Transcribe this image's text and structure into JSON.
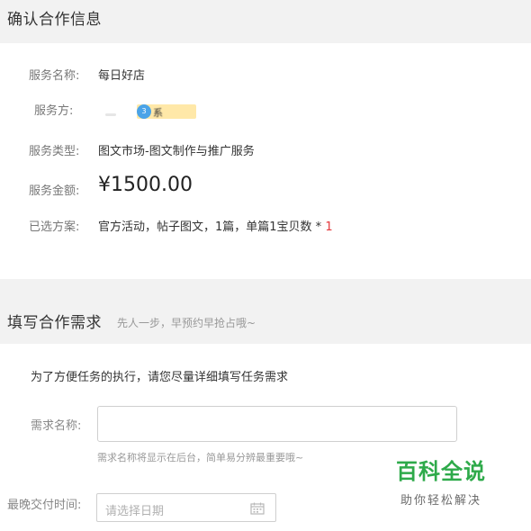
{
  "confirm_section": {
    "title": "确认合作信息",
    "rows": [
      {
        "label": "服务名称:",
        "value": "每日好店"
      },
      {
        "label": "服务方:",
        "value": ""
      },
      {
        "label": "服务类型:",
        "value": "图文市场-图文制作与推广服务"
      },
      {
        "label": "服务金额:",
        "value": "¥1500.00"
      },
      {
        "label": "已选方案:",
        "value": "官方活动，帖子图文，1篇，单篇1宝贝数 * ",
        "quantity": "1"
      }
    ],
    "provider_blurred_text": "系"
  },
  "requirement_section": {
    "title": "填写合作需求",
    "subtitle": "先人一步，早预约早抢占哦~",
    "note": "为了方便任务的执行，请您尽量详细填写任务需求",
    "requirement_name": {
      "label": "需求名称:",
      "value": "",
      "hint": "需求名称将显示在后台，简单易分辨最重要哦~"
    },
    "deadline": {
      "label": "最晚交付时间:",
      "placeholder": "请选择日期"
    }
  },
  "watermark": {
    "big": "百科全说",
    "small": "助你轻松解决"
  },
  "colors": {
    "header_bg": "#f2f2f2",
    "quantity_red": "#e4393c",
    "watermark_green": "#2eaa4a"
  }
}
